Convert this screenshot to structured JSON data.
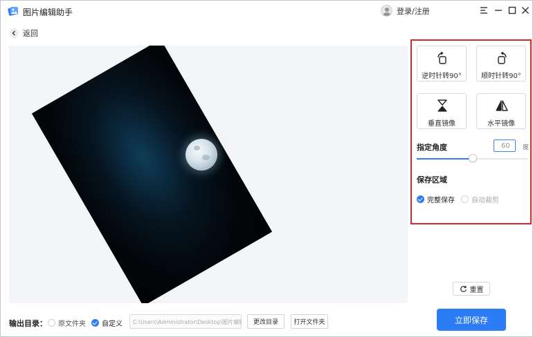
{
  "window": {
    "title": "图片编辑助手",
    "login_label": "登录/注册",
    "icons": {
      "logo": "app-logo-icon",
      "menu": "menu-icon",
      "minimize": "minimize-icon",
      "maximize": "maximize-icon",
      "close": "close-icon"
    }
  },
  "nav": {
    "back_label": "返回"
  },
  "tools": {
    "rotate_ccw_label": "逆时针转90°",
    "rotate_cw_label": "顺时针转90°",
    "flip_vertical_label": "垂直镜像",
    "flip_horizontal_label": "水平镜像"
  },
  "angle": {
    "title": "指定角度",
    "value": "60",
    "unit": "度",
    "slider_fraction": 0.5
  },
  "save_area": {
    "title": "保存区域",
    "options": [
      {
        "label": "完整保存",
        "selected": true
      },
      {
        "label": "自动裁剪",
        "selected": false
      }
    ]
  },
  "reset_label": "重置",
  "output": {
    "label": "输出目录：",
    "options": [
      {
        "label": "原文件夹",
        "selected": false
      },
      {
        "label": "自定义",
        "selected": true
      }
    ],
    "path": "C:\\Users\\Administrator\\Desktop\\图片编辑",
    "change_dir_label": "更改目录",
    "open_folder_label": "打开文件夹"
  },
  "save_now_label": "立即保存",
  "colors": {
    "accent": "#2c7cf6",
    "highlight_border": "#d9262c"
  }
}
